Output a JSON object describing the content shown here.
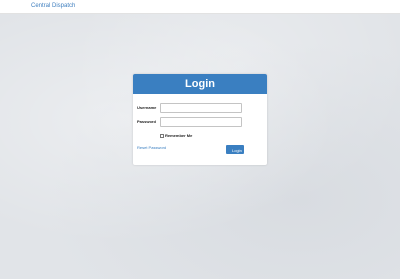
{
  "navbar": {
    "brand": "Central Dispatch"
  },
  "login": {
    "title": "Login",
    "username_label": "Username",
    "username_value": "",
    "password_label": "Password",
    "password_value": "",
    "remember_label": "Remember Me",
    "remember_checked": false,
    "reset_link": "Reset Password",
    "submit_label": "Login"
  },
  "colors": {
    "accent": "#3a7fc1",
    "background": "#e1e4e8",
    "brand_link": "#3f7fbf"
  }
}
